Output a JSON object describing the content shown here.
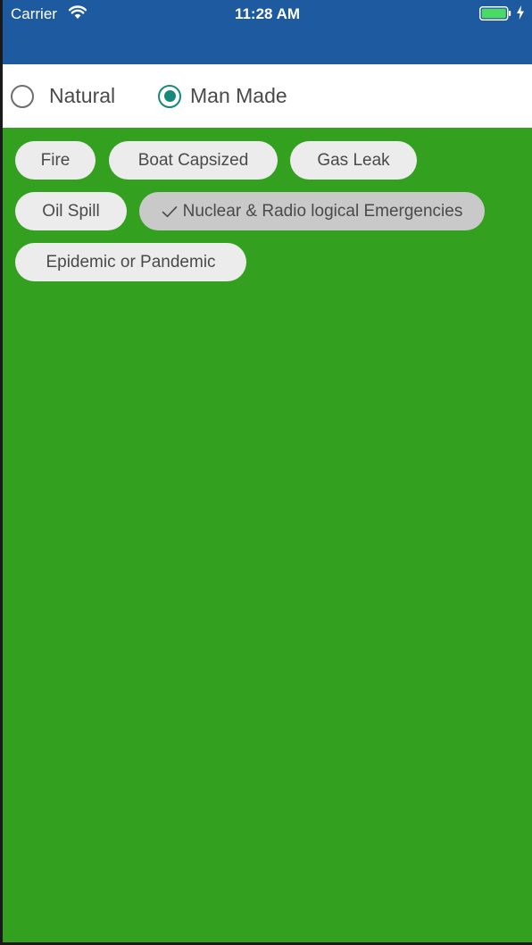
{
  "status_bar": {
    "carrier": "Carrier",
    "time": "11:28 AM",
    "wifi_icon": "wifi-icon",
    "battery_icon": "battery-charging-icon",
    "battery_color": "#4cd964"
  },
  "header": {
    "background_color": "#1d5a9f"
  },
  "disaster_type": {
    "options": [
      {
        "label": "Natural",
        "selected": false
      },
      {
        "label": "Man Made",
        "selected": true
      }
    ],
    "accent_color": "#17887d"
  },
  "content": {
    "background_color": "#33a020"
  },
  "chips": [
    {
      "label": "Fire",
      "selected": false
    },
    {
      "label": "Boat Capsized",
      "selected": false
    },
    {
      "label": "Gas Leak",
      "selected": false
    },
    {
      "label": "Oil Spill",
      "selected": false
    },
    {
      "label": "Nuclear & Radio logical Emergencies",
      "selected": true,
      "icon": "checkmark-icon"
    },
    {
      "label": "Epidemic or Pandemic",
      "selected": false
    }
  ]
}
